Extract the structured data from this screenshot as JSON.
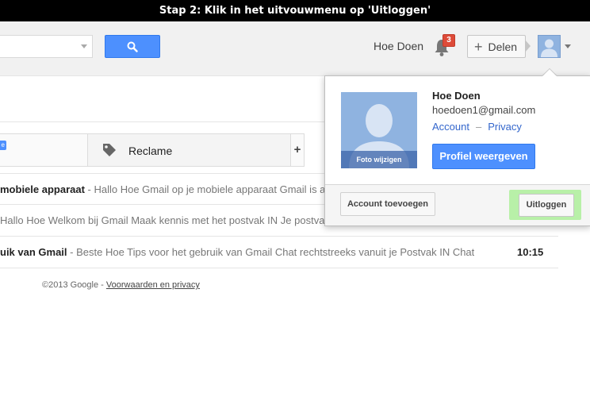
{
  "instruction": "Stap 2: Klik in het uitvouwmenu op 'Uitloggen'",
  "header": {
    "account_name": "Hoe Doen",
    "notification_count": "3",
    "share_label": "Delen"
  },
  "tabs": {
    "reclame_label": "Reclame",
    "add_label": "+"
  },
  "emails": [
    {
      "sender": "mobiele apparaat",
      "snippet": " - Hallo Hoe Gmail op je mobiele apparaat Gmail is altijd",
      "time": ""
    },
    {
      "sender": "",
      "snippet": "Hallo Hoe Welkom bij Gmail Maak kennis met het postvak IN Je postvak",
      "time": ""
    },
    {
      "sender": "uik van Gmail",
      "snippet": " - Beste Hoe Tips voor het gebruik van Gmail Chat rechtstreeks vanuit je Postvak IN Chat m",
      "time": "10:15"
    }
  ],
  "footer": {
    "copyright": "©2013 Google - ",
    "terms_link": "Voorwaarden en privacy"
  },
  "account_popup": {
    "name": "Hoe Doen",
    "email": "hoedoen1@gmail.com",
    "account_link": "Account",
    "separator": "–",
    "privacy_link": "Privacy",
    "change_photo": "Foto wijzigen",
    "profile_button": "Profiel weergeven",
    "add_account_button": "Account toevoegen",
    "logout_button": "Uitloggen"
  },
  "colors": {
    "accent_blue": "#4d90fe",
    "badge_red": "#dd4b39",
    "highlight_green": "#b8f0a8"
  }
}
